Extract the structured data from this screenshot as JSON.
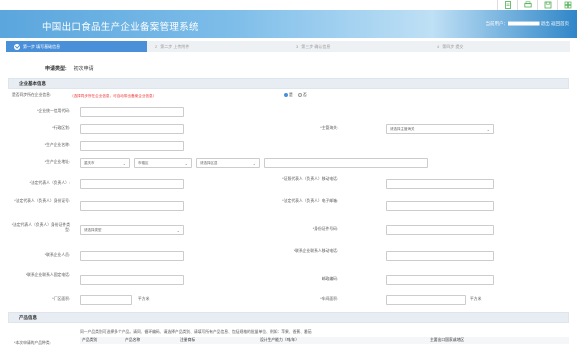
{
  "topicons": [
    "document-icon",
    "print-icon",
    "save-icon",
    "grid-icon"
  ],
  "header": {
    "title": "中国出口食品生产企业备案管理系统",
    "welcome": "当前用户：▇▇▇▇▇▇▇ 退出 返回首页"
  },
  "steps": [
    {
      "num": "1",
      "label": "第一步 填写基础信息"
    },
    {
      "num": "2",
      "label": "第二步 上传附件"
    },
    {
      "num": "3",
      "label": "第三步 确认信息"
    },
    {
      "num": "4",
      "label": "第四步 提交"
    }
  ],
  "apply": {
    "label": "申请类型:",
    "value": "初次申请"
  },
  "basic": {
    "title": "企业基本信息",
    "q_label": "是否同步所在企业信息:",
    "q_note": "（选择同步所在企业信息，可自动带出备案企业信息）",
    "yes": "是",
    "no": "否",
    "credit_code": "*企业统一信用代码:",
    "type_code": "*行政区划:",
    "supervisor": "*主管海关:",
    "supervisor_val": "请选择主管海关",
    "company_name": "*生产企业名称:",
    "address": "*生产企业地址:",
    "province": "重庆市",
    "city": "市辖区",
    "district": "请选择区县",
    "legal_name": "*法定代表人（负责人）:",
    "legal_phone": "*证照代表人（负责人）移动电话:",
    "legal_id": "*法定代表人（负责人）身份证号:",
    "legal_mobile": "*法定代表人（负责人）电子邮箱:",
    "id_type": "*法定代表人（负责人）身份证件类型:",
    "id_type_val": "请选择类型",
    "id_no": "*身份证件号码:",
    "contact": "*联系企业人员:",
    "contact_mobile": "*联系企业联系人移动电话:",
    "contact_phone": "*联系企业联系人固定电话:",
    "postcode": "邮政编码:",
    "factory_area": "*厂区面积:",
    "unit_sqm": "平方米",
    "build_area": "*车间面积:"
  },
  "product": {
    "title": "产品信息",
    "label": "*本次申请的产品种类:",
    "text": "同一产品类别可选择多个产品。请同、循环编码、请选择产品类别、请填写所有产品信息、包括规格的批量单位、例如：苹果、香蕉、番茄",
    "cols": [
      "产品类别",
      "产品名称",
      "注册商标",
      "设计生产能力（吨/年）",
      "主要出口国家或地区"
    ]
  }
}
